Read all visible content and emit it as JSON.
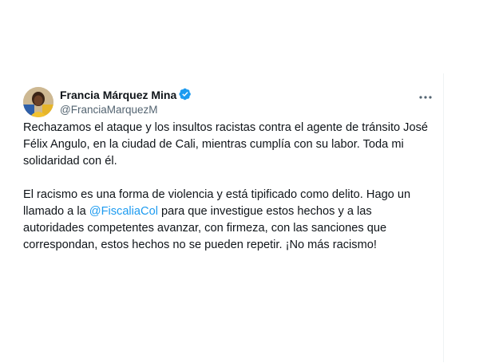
{
  "tweet": {
    "author": {
      "display_name": "Francia Márquez Mina",
      "handle": "@FranciaMarquezM",
      "verified_icon": "verified-badge-icon",
      "avatar_icon": "avatar-photo"
    },
    "more_icon": "more-options-icon",
    "body": {
      "paragraph_1": "Rechazamos el ataque y los insultos racistas contra el agente de tránsito José Félix Angulo, en la ciudad de Cali, mientras cumplía con su labor. Toda mi solidaridad con él.",
      "paragraph_2_before": "El racismo es una forma de violencia y está tipificado como delito. Hago un llamado a la ",
      "mention": "@FiscaliaCol",
      "paragraph_2_after": " para que investigue estos hechos y a las autoridades competentes avanzar, con firmeza, con las sanciones que correspondan, estos hechos no se pueden repetir. ¡No más racismo!"
    },
    "colors": {
      "text": "#0f1419",
      "secondary_text": "#536471",
      "link": "#1d9bf0",
      "verified_badge": "#1d9bf0",
      "border": "#eff3f4"
    }
  }
}
